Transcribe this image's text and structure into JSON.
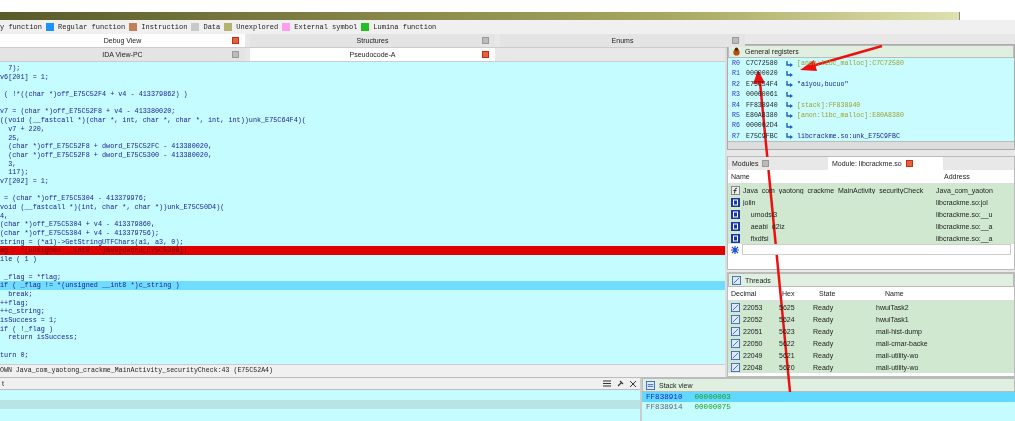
{
  "legend": [
    {
      "label": "y function"
    },
    {
      "label": "Regular function",
      "color": "#1e90ff"
    },
    {
      "label": "Instruction",
      "color": "#c0805c"
    },
    {
      "label": "Data",
      "color": "#c8c8c8"
    },
    {
      "label": "Unexplored",
      "color": "#b4b470"
    },
    {
      "label": "External symbol",
      "color": "#ff9cf0"
    },
    {
      "label": "Lumina function",
      "color": "#22c022"
    }
  ],
  "top_tabs": [
    {
      "label": "Debug View",
      "selected": true
    },
    {
      "label": "Structures",
      "selected": false
    },
    {
      "label": "Enums",
      "selected": false
    }
  ],
  "view_tabs": [
    {
      "label": "IDA View-PC",
      "selected": false
    },
    {
      "label": "Pseudocode-A",
      "selected": true
    }
  ],
  "code": [
    {
      "kind": "normal",
      "text": "  7);"
    },
    {
      "kind": "normal",
      "text": "v6[201] = 1;"
    },
    {
      "kind": "blank"
    },
    {
      "kind": "normal",
      "text": " ( !*((char *)off_E75C52F4 + v4 - 413379862) )"
    },
    {
      "kind": "blank"
    },
    {
      "kind": "normal",
      "text": "v7 = (char *)off_E75C52F8 + v4 - 413380020;"
    },
    {
      "kind": "normal",
      "text": "((void (__fastcall *)(char *, int, char *, char *, int, int))unk_E75C64F4)("
    },
    {
      "kind": "normal",
      "text": "  v7 + 220,"
    },
    {
      "kind": "normal",
      "text": "  25,"
    },
    {
      "kind": "normal",
      "text": "  (char *)off_E75C52F8 + dword_E75C52FC - 413380020,"
    },
    {
      "kind": "normal",
      "text": "  (char *)off_E75C52F8 + dword_E75C5300 - 413380020,"
    },
    {
      "kind": "normal",
      "text": "  3,"
    },
    {
      "kind": "normal",
      "text": "  117);"
    },
    {
      "kind": "normal",
      "text": "v7[202] = 1;"
    },
    {
      "kind": "blank"
    },
    {
      "kind": "normal",
      "text": " = (char *)off_E75C5304 - 413379976;"
    },
    {
      "kind": "normal",
      "text": "void (__fastcall *)(int, char *, char *))unk_E75C50D4)("
    },
    {
      "kind": "normal",
      "text": "4,"
    },
    {
      "kind": "normal",
      "text": "(char *)off_E75C5304 + v4 - 413379860,"
    },
    {
      "kind": "normal",
      "text": "(char *)off_E75C5304 + v4 - 413379756);"
    },
    {
      "kind": "normal",
      "text": "string = (*a1)->GetStringUTFChars(a1, a3, 0);"
    },
    {
      "kind": "breakpoint",
      "text": "ag = *(unsigned __int8 **)&v8[dword_E75C5308];"
    },
    {
      "kind": "normal",
      "text": "ile ( 1 )"
    },
    {
      "kind": "blank"
    },
    {
      "kind": "normal",
      "text": " _flag = *flag;"
    },
    {
      "kind": "current",
      "text": "if ( _flag != *(unsigned __int8 *)c_string )"
    },
    {
      "kind": "normal",
      "text": "  break;"
    },
    {
      "kind": "normal",
      "text": "++flag;"
    },
    {
      "kind": "normal",
      "text": "++c_string;"
    },
    {
      "kind": "normal",
      "text": "isSuccess = 1;"
    },
    {
      "kind": "normal",
      "text": "if ( !_flag )"
    },
    {
      "kind": "normal",
      "text": "  return isSuccess;"
    },
    {
      "kind": "blank"
    },
    {
      "kind": "normal",
      "text": "turn 0;"
    }
  ],
  "status_line": "OWN Java_com_yaotong_crackme_MainActivity_securityCheck:43 (E75C52A4)",
  "registers": {
    "title": "General registers",
    "rows": [
      {
        "name": "R0",
        "value": "C7C72580",
        "note": "[anon:libc_malloc]:C7C72580",
        "kind": "label"
      },
      {
        "name": "R1",
        "value": "00000020"
      },
      {
        "name": "R2",
        "value": "E75C54F4",
        "note": "\"aiyou,bucuo\"",
        "kind": "string"
      },
      {
        "name": "R3",
        "value": "00000061"
      },
      {
        "name": "R4",
        "value": "FF838940",
        "note": "[stack]:FF838940",
        "kind": "label"
      },
      {
        "name": "R5",
        "value": "E80A8380",
        "note": "[anon:libc_malloc]:E80A8380",
        "kind": "label"
      },
      {
        "name": "R6",
        "value": "000002D4"
      },
      {
        "name": "R7",
        "value": "E75C9FBC",
        "note": "libcrackme.so:unk_E75C9FBC",
        "kind": "code"
      }
    ]
  },
  "modules": {
    "tabs": [
      {
        "label": "Modules",
        "selected": false
      },
      {
        "label": "Module: libcrackme.so",
        "selected": true
      }
    ],
    "columns": [
      "Name",
      "Address"
    ],
    "rows": [
      {
        "kind": "function",
        "name": "Java_com_yaotong_crackme_MainActivity_securityCheck",
        "address": "Java_com_yaoton"
      },
      {
        "kind": "data",
        "name": "jolin",
        "address": "libcrackme.so:jol"
      },
      {
        "kind": "data",
        "name": "__umodsi3",
        "address": "libcrackme.so:__u"
      },
      {
        "kind": "data",
        "name": "__aeabi_d2iz",
        "address": "libcrackme.so:__a"
      },
      {
        "kind": "data",
        "name": "__fixdfsi",
        "address": "libcrackme.so:__a"
      }
    ]
  },
  "threads": {
    "title": "Threads",
    "columns": [
      "Decimal",
      "Hex",
      "State",
      "Name"
    ],
    "rows": [
      {
        "decimal": "22053",
        "hex": "5625",
        "state": "Ready",
        "name": "hwuiTask2"
      },
      {
        "decimal": "22052",
        "hex": "5624",
        "state": "Ready",
        "name": "hwuiTask1"
      },
      {
        "decimal": "22051",
        "hex": "5623",
        "state": "Ready",
        "name": "mali-hist-dump"
      },
      {
        "decimal": "22050",
        "hex": "5622",
        "state": "Ready",
        "name": "mali-cmar-backe"
      },
      {
        "decimal": "22049",
        "hex": "5621",
        "state": "Ready",
        "name": "mali-utility-wo"
      },
      {
        "decimal": "22048",
        "hex": "5620",
        "state": "Ready",
        "name": "mali-utility-wo"
      }
    ]
  },
  "output": {
    "title": "t"
  },
  "stack": {
    "title": "Stack view",
    "rows": [
      {
        "address": "FF838910",
        "value": "00000003",
        "selected": true
      },
      {
        "address": "FF838914",
        "value": "00000075",
        "selected": false
      }
    ]
  }
}
